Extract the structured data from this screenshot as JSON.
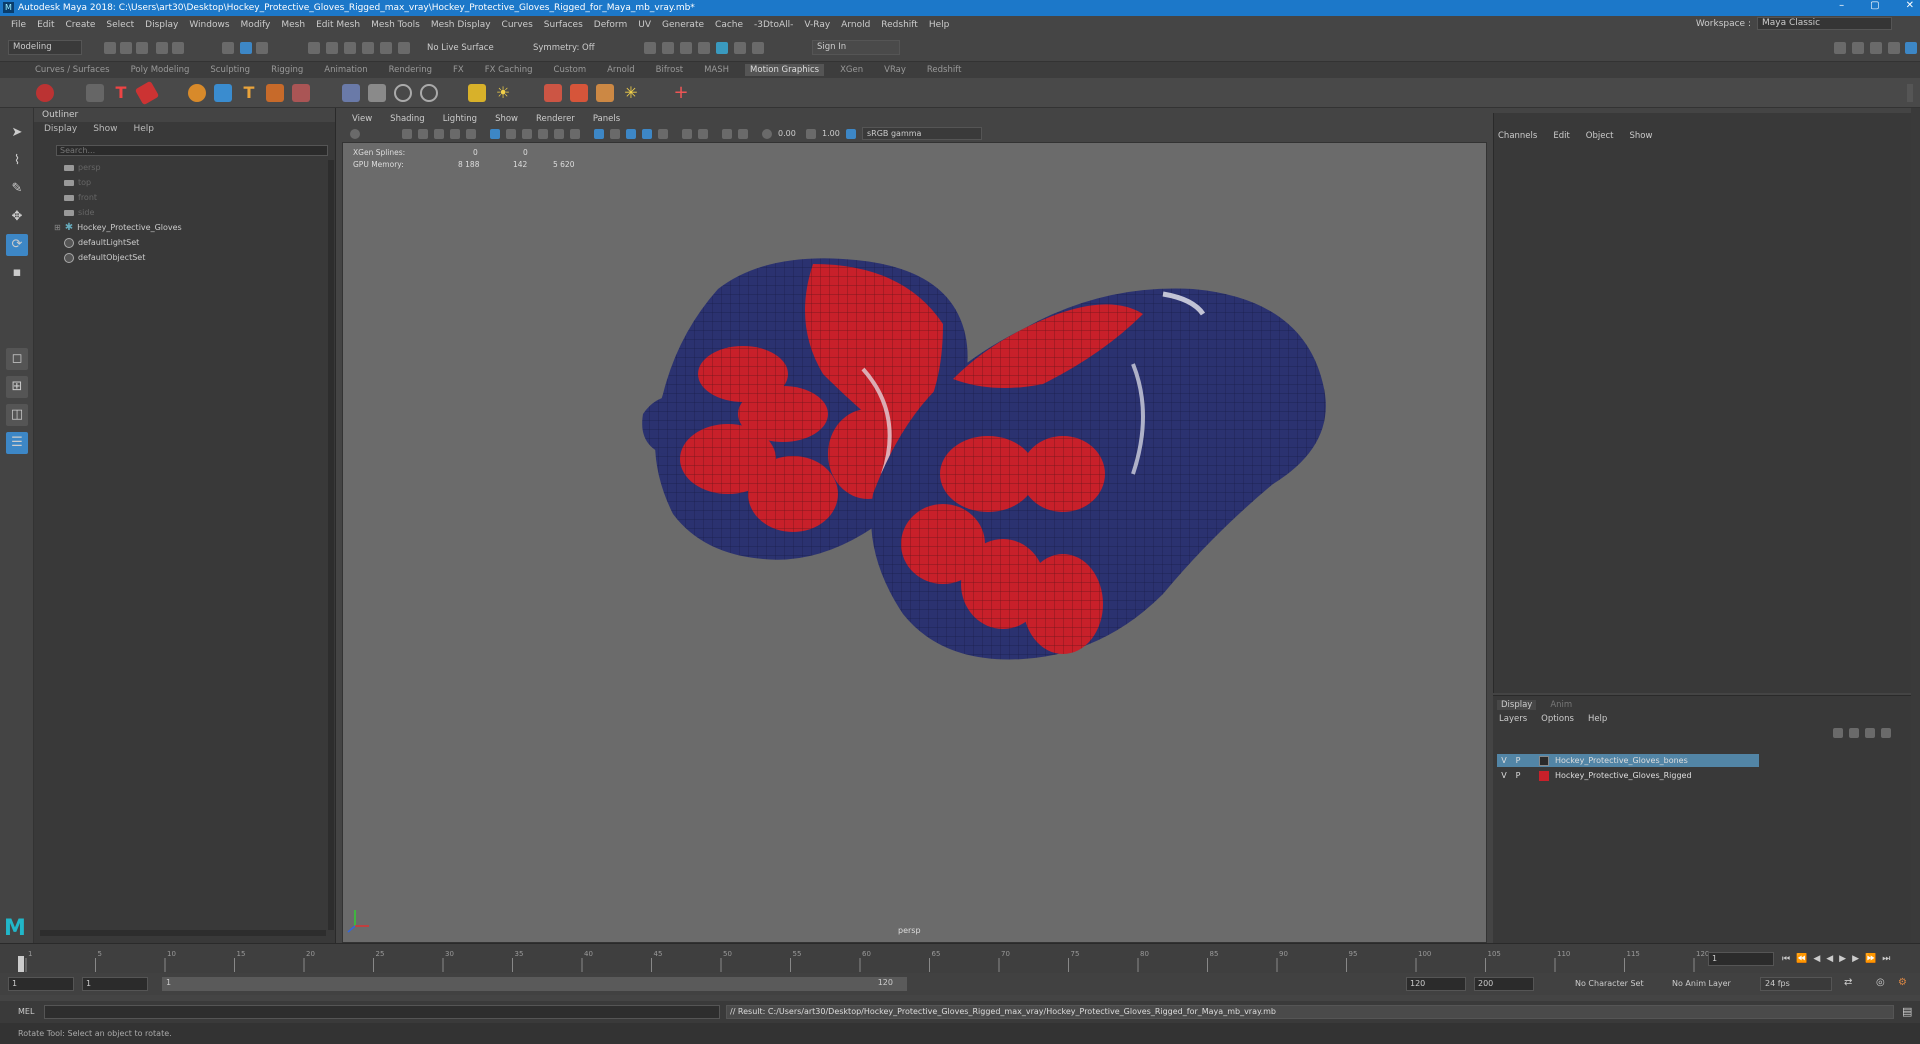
{
  "window": {
    "title": "Autodesk Maya 2018: C:\\Users\\art30\\Desktop\\Hockey_Protective_Gloves_Rigged_max_vray\\Hockey_Protective_Gloves_Rigged_for_Maya_mb_vray.mb*",
    "logo": "M",
    "btn_min": "–",
    "btn_max": "▢",
    "btn_close": "✕"
  },
  "menubar": {
    "items": [
      "File",
      "Edit",
      "Create",
      "Select",
      "Display",
      "Windows",
      "Modify",
      "Mesh",
      "Edit Mesh",
      "Mesh Tools",
      "Mesh Display",
      "Curves",
      "Surfaces",
      "Deform",
      "UV",
      "Generate",
      "Cache",
      "-3DtoAll-",
      "V-Ray",
      "Arnold",
      "Redshift",
      "Help"
    ],
    "workspace_label": "Workspace :",
    "workspace_value": "Maya Classic"
  },
  "toolbar": {
    "mode": "Modeling",
    "live_surface": "No Live Surface",
    "symmetry": "Symmetry: Off",
    "sign_in": "Sign In"
  },
  "shelf": {
    "tabs": [
      "Curves / Surfaces",
      "Poly Modeling",
      "Sculpting",
      "Rigging",
      "Animation",
      "Rendering",
      "FX",
      "FX Caching",
      "Custom",
      "Arnold",
      "Bifrost",
      "MASH",
      "Motion Graphics",
      "XGen",
      "VRay",
      "Redshift"
    ],
    "active_tab": "Motion Graphics"
  },
  "outliner": {
    "title": "Outliner",
    "menu": [
      "Display",
      "Show",
      "Help"
    ],
    "search_placeholder": "Search...",
    "items": [
      {
        "label": "persp",
        "kind": "camera",
        "dim": true
      },
      {
        "label": "top",
        "kind": "camera",
        "dim": true
      },
      {
        "label": "front",
        "kind": "camera",
        "dim": true
      },
      {
        "label": "side",
        "kind": "camera",
        "dim": true
      },
      {
        "label": "Hockey_Protective_Gloves",
        "kind": "joint",
        "dim": false
      },
      {
        "label": "defaultLightSet",
        "kind": "set",
        "dim": false
      },
      {
        "label": "defaultObjectSet",
        "kind": "set",
        "dim": false
      }
    ]
  },
  "viewport": {
    "menu": [
      "View",
      "Shading",
      "Lighting",
      "Show",
      "Renderer",
      "Panels"
    ],
    "exposure": "0.00",
    "gamma": "1.00",
    "colorspace": "sRGB gamma",
    "hud": {
      "xgen_label": "XGen Splines:",
      "xgen_v1": "0",
      "xgen_v2": "0",
      "gpu_label": "GPU Memory:",
      "gpu_v1": "8 188",
      "gpu_v2": "142",
      "gpu_v3": "5 620"
    },
    "camera_label": "persp"
  },
  "channelbox": {
    "menu": [
      "Channels",
      "Edit",
      "Object",
      "Show"
    ]
  },
  "layers": {
    "tabs": [
      "Display",
      "Anim"
    ],
    "menu": [
      "Layers",
      "Options",
      "Help"
    ],
    "rows": [
      {
        "v": "V",
        "p": "P",
        "name": "Hockey_Protective_Gloves_bones",
        "color": "#2a2a2a",
        "selected": true
      },
      {
        "v": "V",
        "p": "P",
        "name": "Hockey_Protective_Gloves_Rigged",
        "color": "#c8202a",
        "selected": false
      }
    ]
  },
  "timeline": {
    "current_frame": "1",
    "ticks": [
      "1",
      "5",
      "10",
      "15",
      "20",
      "25",
      "30",
      "35",
      "40",
      "45",
      "50",
      "55",
      "60",
      "65",
      "70",
      "75",
      "80",
      "85",
      "90",
      "95",
      "100",
      "105",
      "110",
      "115",
      "120"
    ]
  },
  "range": {
    "start": "1",
    "start2": "1",
    "slider_start": "1",
    "slider_end": "120",
    "end": "120",
    "end2": "200",
    "character_set": "No Character Set",
    "anim_layer": "No Anim Layer",
    "fps": "24 fps"
  },
  "cmdline": {
    "label": "MEL",
    "result": "// Result: C:/Users/art30/Desktop/Hockey_Protective_Gloves_Rigged_max_vray/Hockey_Protective_Gloves_Rigged_for_Maya_mb_vray.mb"
  },
  "helpline": "Rotate Tool: Select an object to rotate.",
  "colors": {
    "title_blue": "#1c78c9",
    "select_blue": "#3d87c6",
    "glove_red": "#c8202a",
    "glove_navy": "#2b3270"
  }
}
